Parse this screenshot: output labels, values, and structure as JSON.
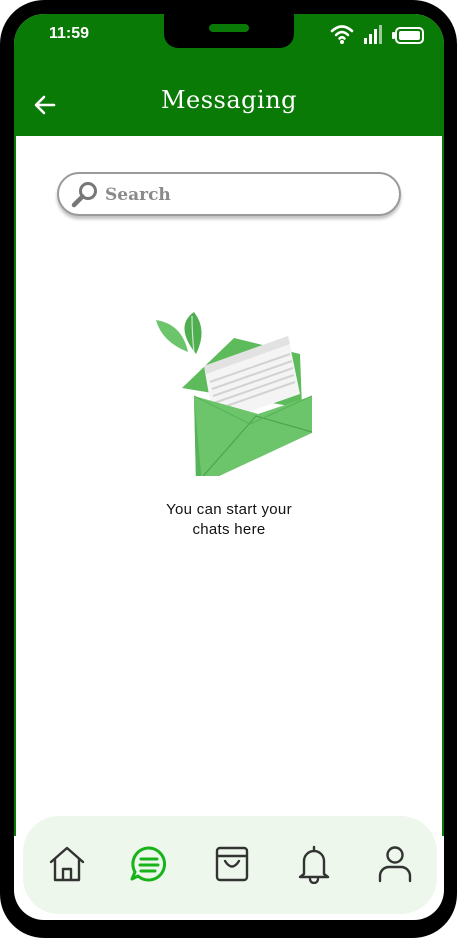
{
  "status_bar": {
    "time": "11:59"
  },
  "header": {
    "title": "Messaging",
    "back_icon": "back-arrow-icon"
  },
  "search": {
    "placeholder": "Search",
    "value": "",
    "icon": "search-icon"
  },
  "empty_state": {
    "illustration": "open-envelope-illustration",
    "line1": "You can start  your",
    "line2": "chats here"
  },
  "bottom_nav": {
    "items": [
      {
        "icon": "home-icon",
        "active": false
      },
      {
        "icon": "chat-icon",
        "active": true
      },
      {
        "icon": "shopping-bag-icon",
        "active": false
      },
      {
        "icon": "bell-icon",
        "active": false
      },
      {
        "icon": "profile-icon",
        "active": false
      }
    ]
  },
  "colors": {
    "brand_green": "#0a7a06",
    "active_green": "#18b318",
    "nav_background": "#eef7ec",
    "envelope_green": "#6cc56a"
  }
}
